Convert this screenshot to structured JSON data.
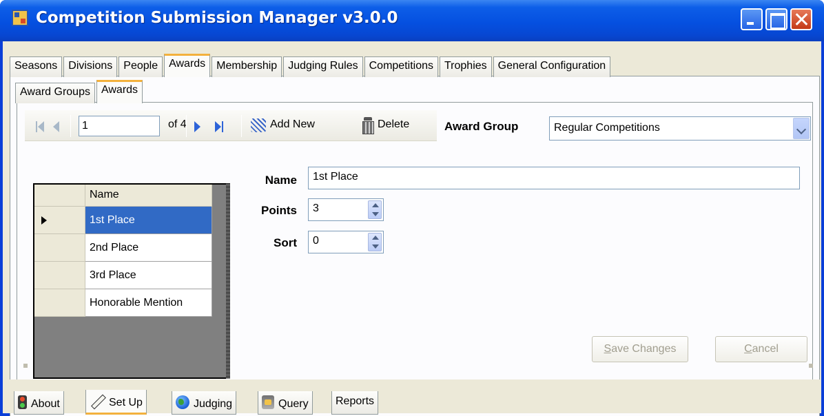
{
  "window": {
    "title": "Competition Submission Manager v3.0.0"
  },
  "main_tabs": [
    {
      "label": "Seasons"
    },
    {
      "label": "Divisions"
    },
    {
      "label": "People"
    },
    {
      "label": "Awards"
    },
    {
      "label": "Membership"
    },
    {
      "label": "Judging Rules"
    },
    {
      "label": "Competitions"
    },
    {
      "label": "Trophies"
    },
    {
      "label": "General Configuration"
    }
  ],
  "main_tabs_active": "Awards",
  "sub_tabs": [
    {
      "label": "Award Groups"
    },
    {
      "label": "Awards"
    }
  ],
  "sub_tabs_active": "Awards",
  "navigator": {
    "position": "1",
    "count_text": "of 4",
    "add_new_label": "Add New",
    "delete_label": "Delete"
  },
  "award_group": {
    "label": "Award Group",
    "selected": "Regular Competitions"
  },
  "grid": {
    "column_header": "Name",
    "rows": [
      {
        "name": "1st Place",
        "selected": true
      },
      {
        "name": "2nd Place",
        "selected": false
      },
      {
        "name": "3rd Place",
        "selected": false
      },
      {
        "name": "Honorable Mention",
        "selected": false
      }
    ]
  },
  "form": {
    "name_label": "Name",
    "name_value": "1st Place",
    "points_label": "Points",
    "points_value": "3",
    "sort_label": "Sort",
    "sort_value": "0"
  },
  "buttons": {
    "save_prefix": "",
    "save_underline": "S",
    "save_rest": "ave Changes",
    "cancel_underline": "C",
    "cancel_rest": "ancel"
  },
  "bottom_tabs": [
    {
      "label": "About",
      "icon": "traffic-light-icon"
    },
    {
      "label": "Set Up",
      "icon": "pencil-icon"
    },
    {
      "label": "Judging",
      "icon": "globe-icon"
    },
    {
      "label": "Query",
      "icon": "database-icon"
    },
    {
      "label": "Reports",
      "icon": ""
    }
  ],
  "bottom_tabs_active": "Set Up"
}
